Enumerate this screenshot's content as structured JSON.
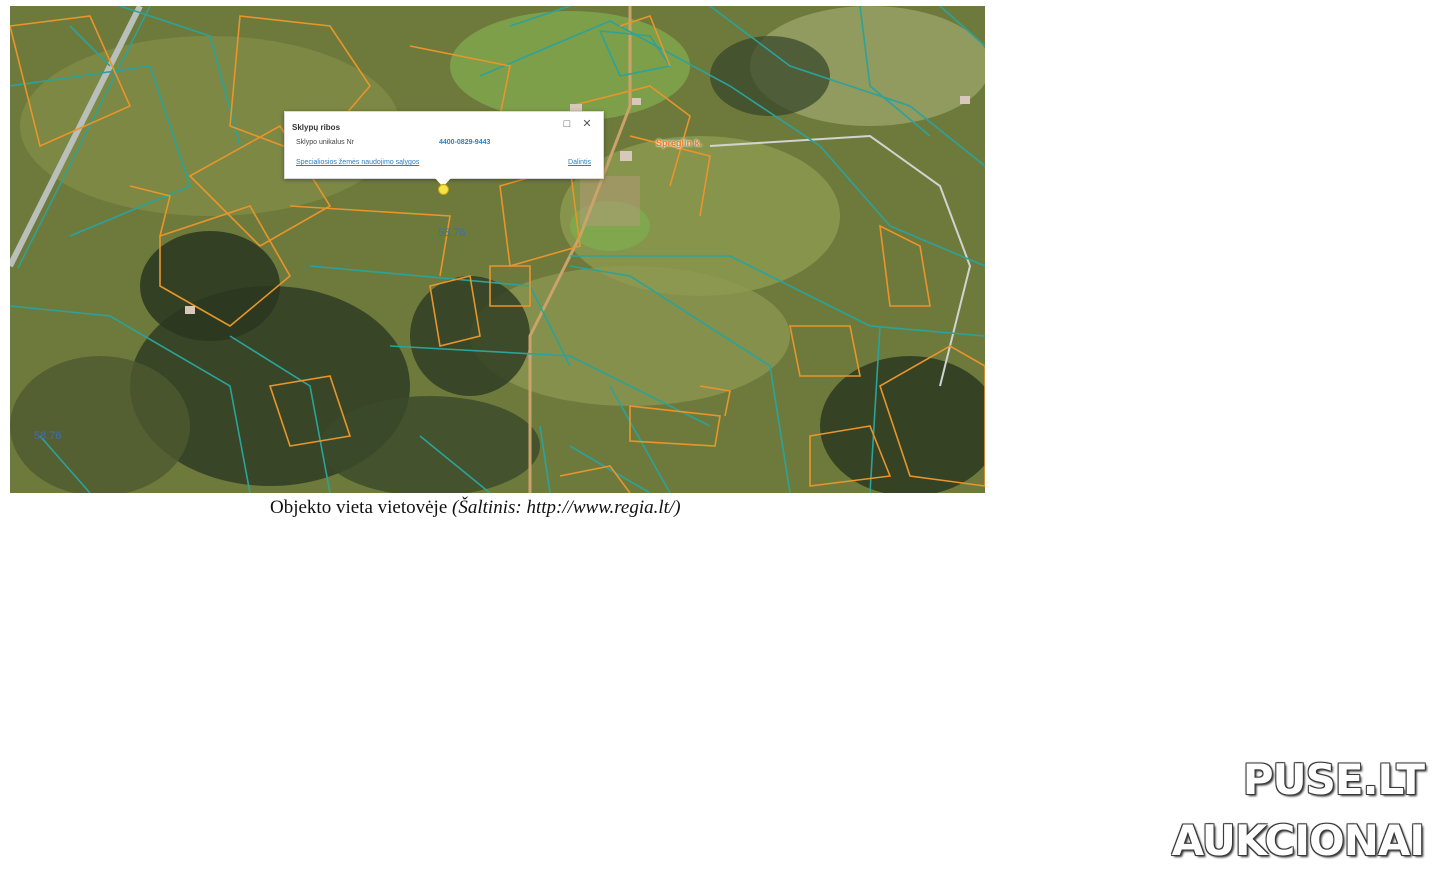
{
  "popup": {
    "title": "Sklypų ribos",
    "row_label": "Sklypo unikalus Nr",
    "row_value": "4400-0829-9443",
    "link": "Specialiosios žemės naudojimo sąlygos",
    "share": "Dalintis"
  },
  "map": {
    "place_label": "Spreglin k.",
    "parcel_area": "58.76",
    "parcel_area_2": "58.76",
    "colors": {
      "parcel_boundary": "#e8952b",
      "cadastral_boundary": "#2ba39a",
      "road": "#9aa39a"
    }
  },
  "caption": {
    "text": "Objekto vieta vietovėje ",
    "source": "(Šaltinis: http://www.regia.lt/)"
  },
  "watermark": {
    "line1": "PUSE.LT",
    "line2": "AUKCIONAI"
  }
}
